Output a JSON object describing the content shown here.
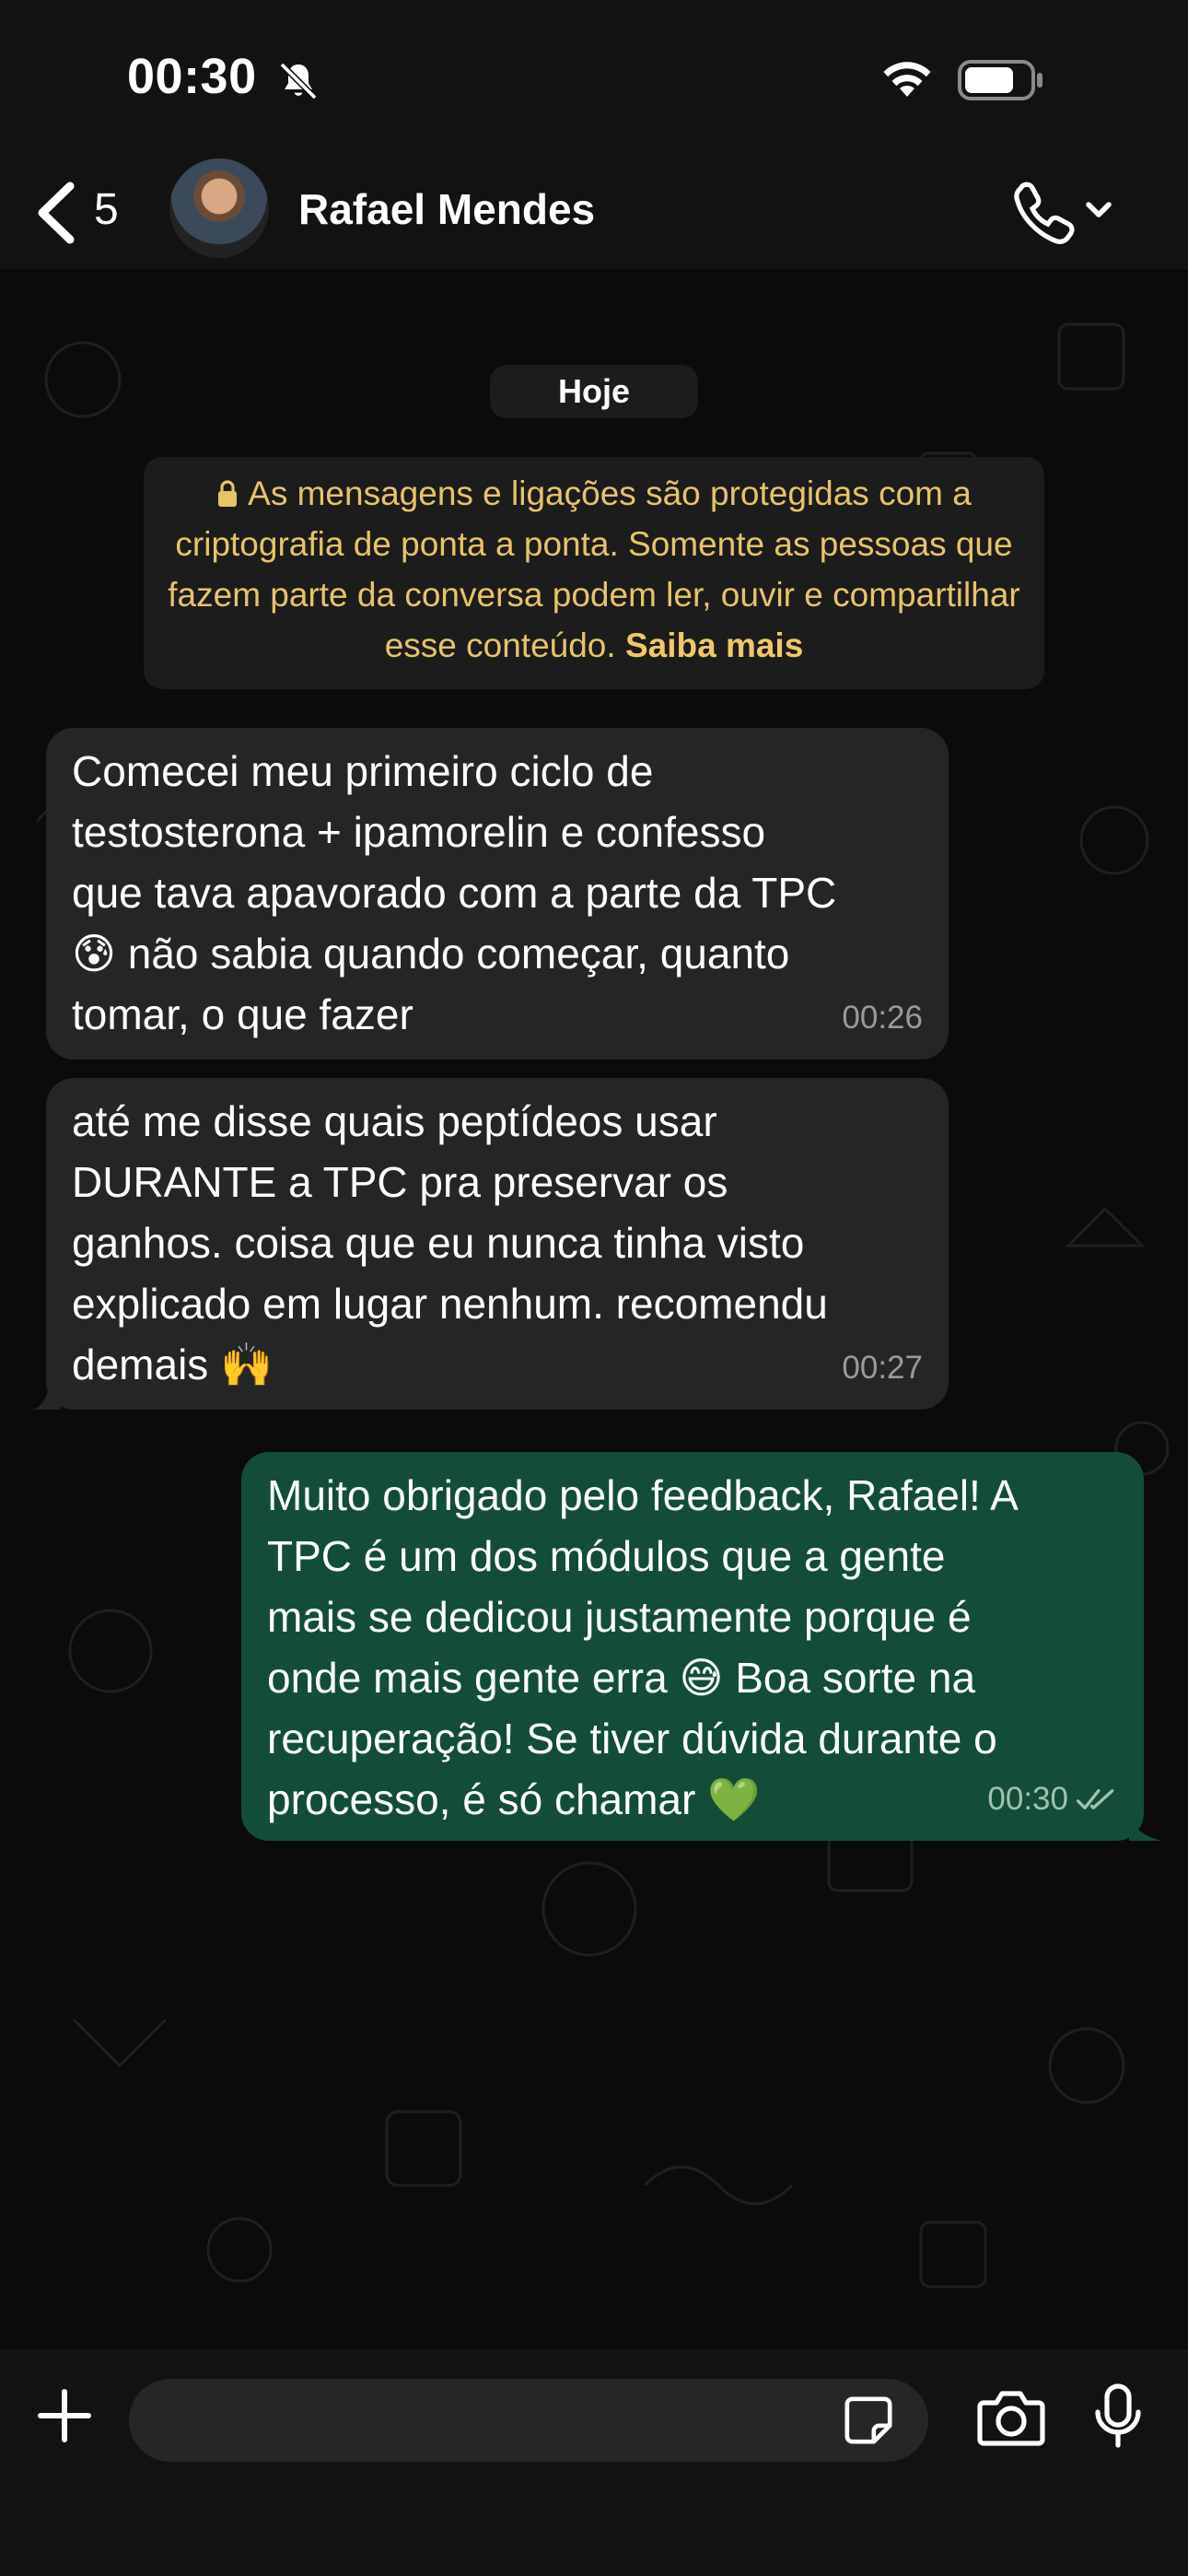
{
  "status_bar": {
    "time": "00:30"
  },
  "header": {
    "back_count": "5",
    "contact_name": "Rafael Mendes"
  },
  "chat": {
    "date_label": "Hoje",
    "encryption_notice": "As mensagens e ligações são protegidas com a criptografia de ponta a ponta. Somente as pessoas que fazem parte da conversa podem ler, ouvir e compartilhar esse conteúdo.",
    "encryption_link": "Saiba mais",
    "messages": [
      {
        "direction": "incoming",
        "text": "Comecei meu primeiro ciclo de\ntestosterona + ipamorelin e confesso\nque tava apavorado com a parte da TPC\n😰 não sabia quando começar, quanto\ntomar, o que fazer",
        "time": "00:26"
      },
      {
        "direction": "incoming",
        "text": "até me disse quais peptídeos usar\nDURANTE a TPC pra preservar os\nganhos. coisa que eu nunca tinha visto\nexplicado em lugar nenhum. recomendu\ndemais 🙌",
        "time": "00:27"
      },
      {
        "direction": "outgoing",
        "text": "Muito obrigado pelo feedback, Rafael! A\nTPC é um dos módulos que a gente\nmais se dedicou justamente porque é\nonde mais gente erra 😅 Boa sorte na\nrecuperação! Se tiver dúvida durante o\nprocesso, é só chamar 💚",
        "time": "00:30",
        "status": "read"
      }
    ]
  },
  "composer": {
    "placeholder": ""
  },
  "colors": {
    "incoming_bubble": "#242626",
    "outgoing_bubble": "#134d37",
    "encryption_text": "#e8c36a",
    "background": "#0b0b0b"
  },
  "icons": [
    "bell-off-icon",
    "wifi-icon",
    "battery-icon",
    "chevron-left-icon",
    "phone-icon",
    "chevron-down-icon",
    "lock-icon",
    "double-check-icon",
    "plus-icon",
    "sticker-icon",
    "camera-icon",
    "mic-icon"
  ]
}
